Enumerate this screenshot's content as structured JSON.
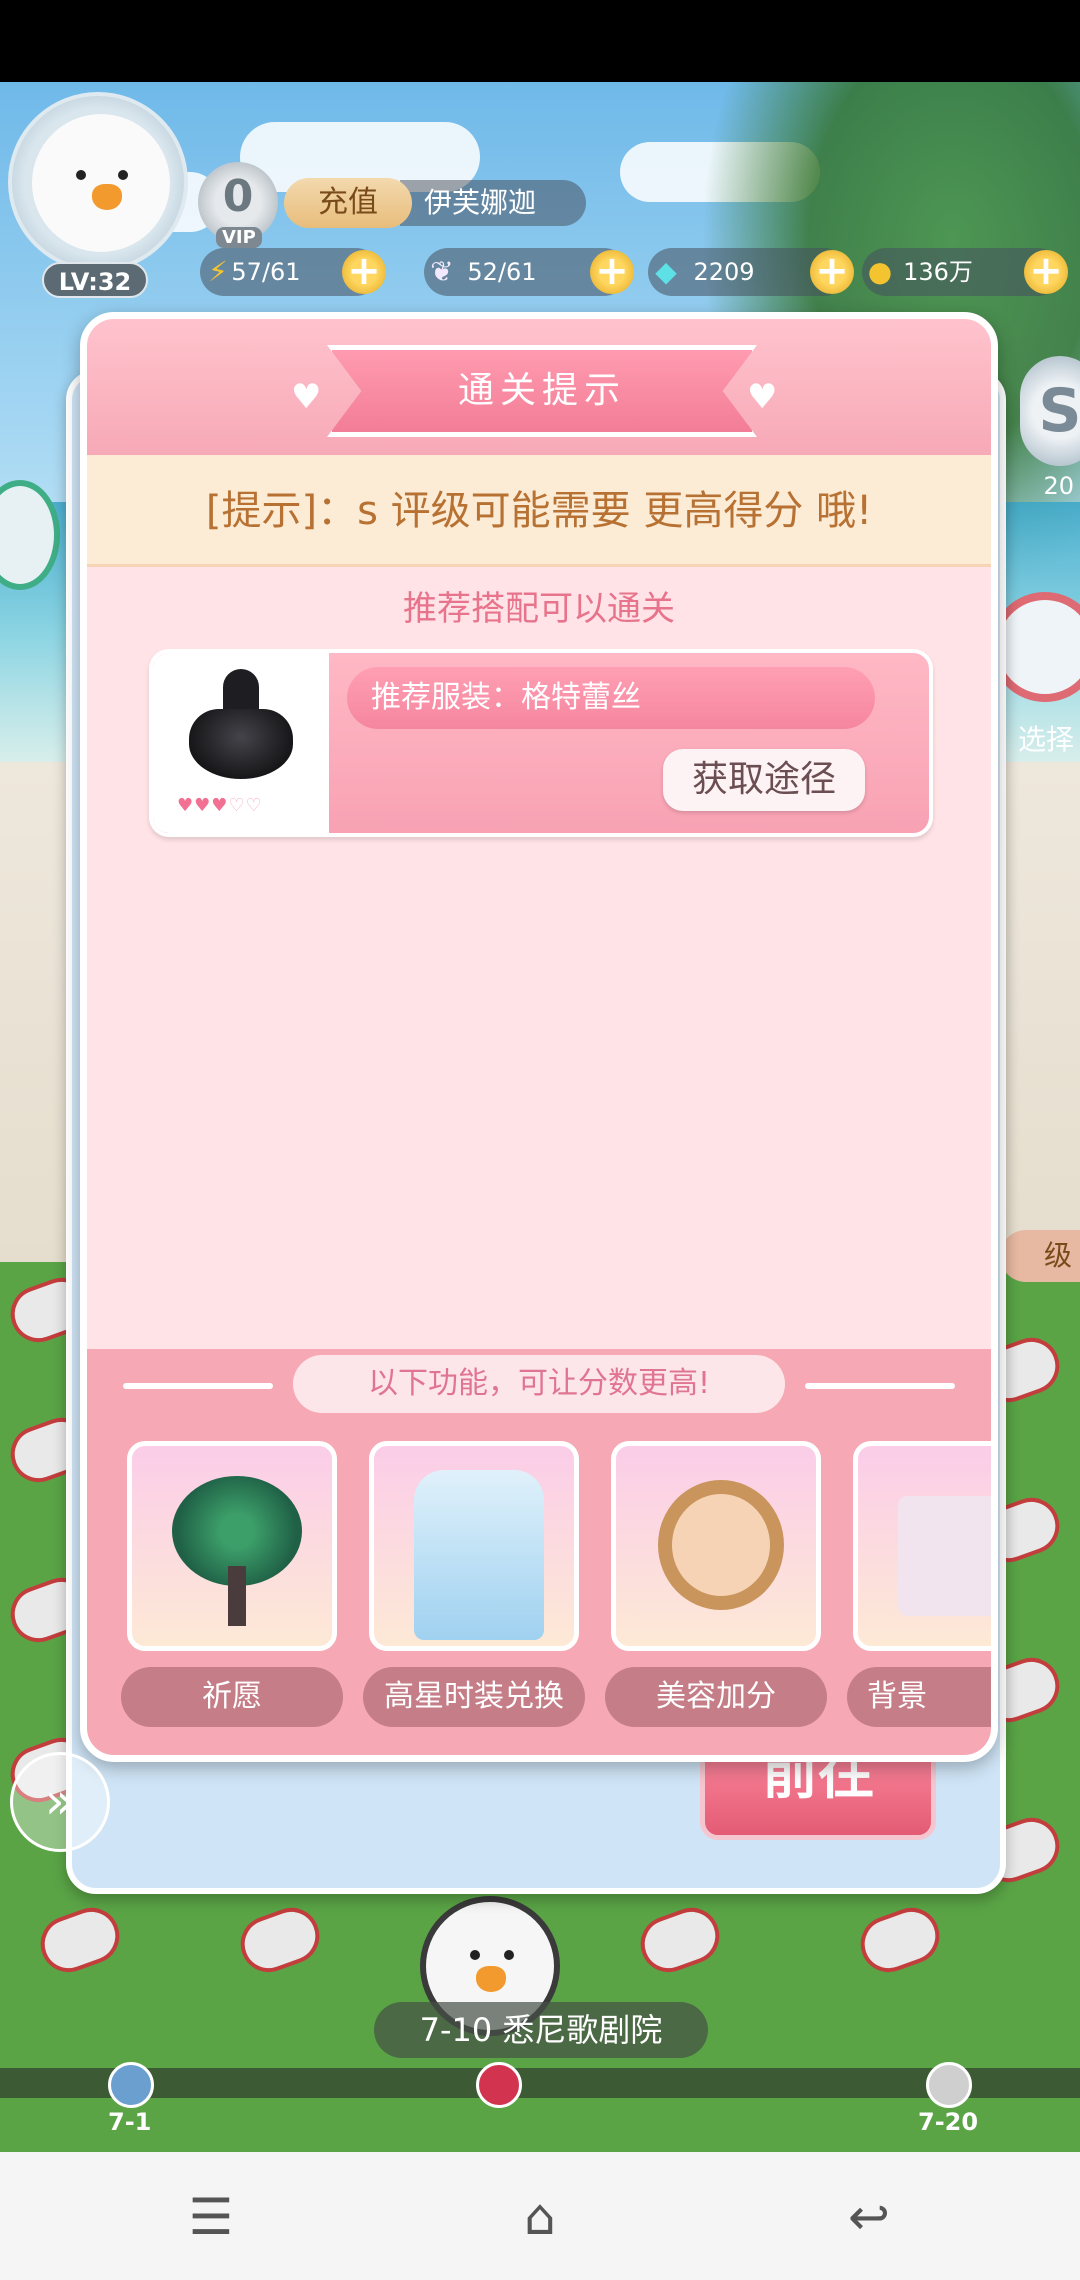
{
  "hud": {
    "level": "LV:32",
    "vip_level": "0",
    "vip_label": "VIP",
    "recharge_label": "充值",
    "username": "伊芙娜迦",
    "resources": [
      {
        "icon": "lightning-icon",
        "value": "57/61"
      },
      {
        "icon": "wing-icon",
        "value": "52/61"
      },
      {
        "icon": "diamond-icon",
        "value": "2209"
      },
      {
        "icon": "coin-icon",
        "value": "136万"
      }
    ]
  },
  "side": {
    "rank_letter": "S",
    "rank_count": "20",
    "select_label": "选择",
    "level_label": "级"
  },
  "dialog": {
    "title": "通关提示",
    "tip": "[提示]：s 评级可能需要 更高得分 哦!",
    "recommend_title": "推荐搭配可以通关",
    "recommended_outfit": "推荐服装：格特蕾丝",
    "rating_hearts": {
      "filled": 3,
      "total": 5
    },
    "get_method_button": "获取途径",
    "boost_title": "以下功能，可让分数更高!",
    "features": [
      {
        "label": "祈愿",
        "icon": "wishing-tree-icon"
      },
      {
        "label": "高星时装兑换",
        "icon": "blue-dress-icon"
      },
      {
        "label": "美容加分",
        "icon": "makeup-girl-icon"
      },
      {
        "label": "背景",
        "icon": "background-card-icon"
      }
    ]
  },
  "back_panel": {
    "go_button": "前往"
  },
  "map": {
    "stage_name": "7-10 悉尼歌剧院",
    "nodes": [
      {
        "label": "7-1",
        "color": "#6a9fd0"
      },
      {
        "label": "",
        "color": "#d2344f"
      },
      {
        "label": "7-20",
        "color": "#cfcfcf"
      }
    ]
  },
  "colors": {
    "accent_pink": "#f7a9b7",
    "tip_text": "#b77133",
    "heart_on": "#f27092"
  }
}
